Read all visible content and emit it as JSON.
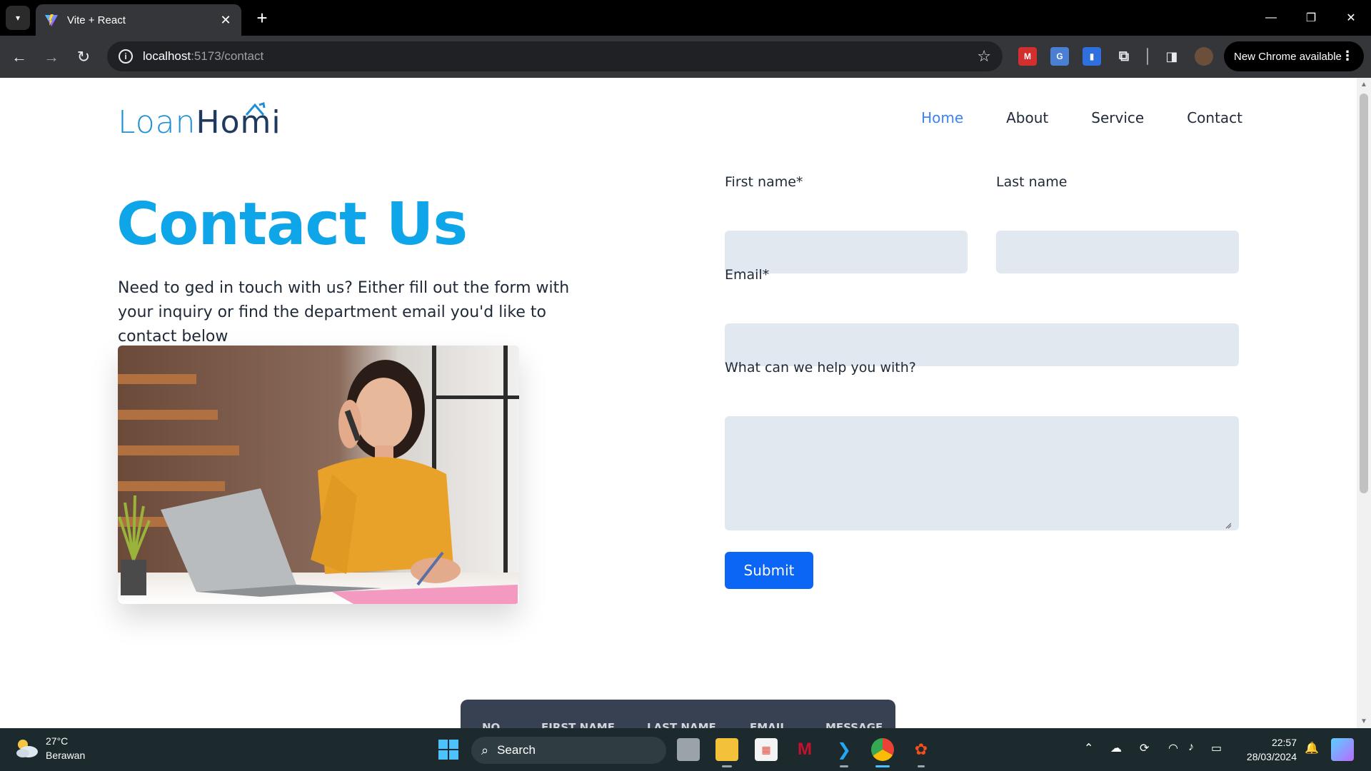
{
  "browser": {
    "tab_title": "Vite + React",
    "url_host": "localhost",
    "url_path": ":5173/contact",
    "update_label": "New Chrome available"
  },
  "site": {
    "logo_part1": "Loan",
    "logo_part2": "Homi",
    "nav": [
      {
        "label": "Home",
        "active": true
      },
      {
        "label": "About",
        "active": false
      },
      {
        "label": "Service",
        "active": false
      },
      {
        "label": "Contact",
        "active": false
      }
    ]
  },
  "contact": {
    "heading": "Contact Us",
    "intro": "Need to ged in touch with us? Either fill out the form with your inquiry or find the department email you'd like to contact below"
  },
  "form": {
    "first_name_label": "First name*",
    "last_name_label": "Last name",
    "email_label": "Email*",
    "message_label": "What can we help you with?",
    "first_name_value": "",
    "last_name_value": "",
    "email_value": "",
    "message_value": "",
    "submit_label": "Submit"
  },
  "table": {
    "headers": [
      "NO",
      "FIRST NAME",
      "LAST NAME",
      "EMAIL",
      "MESSAGE"
    ]
  },
  "taskbar": {
    "weather_temp": "27°C",
    "weather_desc": "Berawan",
    "search_label": "Search",
    "time": "22:57",
    "date": "28/03/2024"
  },
  "colors": {
    "accent": "#0ea5e9",
    "nav_active": "#3b82f6",
    "input_bg": "#e2e8f0",
    "submit_bg": "#0b66f5",
    "table_header_bg": "#374151"
  },
  "icons": [
    "tab-search-icon",
    "vite-favicon",
    "close-icon",
    "plus-icon",
    "minimize-icon",
    "restore-icon",
    "window-close-icon",
    "back-icon",
    "forward-icon",
    "reload-icon",
    "info-icon",
    "star-icon",
    "extensions-icon",
    "side-panel-icon",
    "profile-avatar",
    "more-icon",
    "windows-start-icon",
    "search-icon"
  ]
}
